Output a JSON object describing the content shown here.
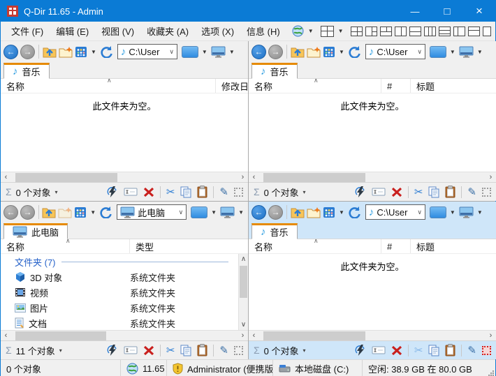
{
  "window": {
    "title": "Q-Dir 11.65 - Admin"
  },
  "menu": {
    "items": [
      "文件 (F)",
      "编辑 (E)",
      "视图 (V)",
      "收藏夹 (A)",
      "选项 (X)",
      "信息 (H)"
    ]
  },
  "panes": [
    {
      "name": "top-left",
      "active": false,
      "address": "C:\\User",
      "tab": "音乐",
      "columns": [
        "名称",
        "修改日"
      ],
      "empty_text": "此文件夹为空。",
      "status": {
        "count": "0 个对象"
      }
    },
    {
      "name": "top-right",
      "active": false,
      "address": "C:\\User",
      "tab": "音乐",
      "columns": [
        "名称",
        "#",
        "标题"
      ],
      "empty_text": "此文件夹为空。",
      "status": {
        "count": "0 个对象"
      }
    },
    {
      "name": "bottom-left",
      "active": false,
      "address": "此电脑",
      "tab": "此电脑",
      "columns": [
        "名称",
        "类型"
      ],
      "group": "文件夹 (7)",
      "rows": [
        {
          "name": "3D 对象",
          "type": "系统文件夹"
        },
        {
          "name": "视频",
          "type": "系统文件夹"
        },
        {
          "name": "图片",
          "type": "系统文件夹"
        },
        {
          "name": "文档",
          "type": "系统文件夹"
        }
      ],
      "status": {
        "count": "11 个对象"
      }
    },
    {
      "name": "bottom-right",
      "active": true,
      "address": "C:\\User",
      "tab": "音乐",
      "columns": [
        "名称",
        "#",
        "标题"
      ],
      "empty_text": "此文件夹为空。",
      "status": {
        "count": "0 个对象"
      }
    }
  ],
  "statusbar": {
    "objects": "0 个对象",
    "version": "11.65",
    "user": "Administrator (便携版",
    "drive": "本地磁盘 (C:)",
    "space": "空闲: 38.9 GB 在 80.0 GB"
  },
  "glyphs": {
    "back": "←",
    "forward": "→",
    "dropdown": "▼",
    "chevron": "∨",
    "caret_up": "∧",
    "scroll_left": "‹",
    "scroll_right": "›",
    "scroll_up": "∧",
    "scroll_down": "∨",
    "sigma": "Σ",
    "count_dropdown": "▾",
    "music": "♪",
    "minimize": "—",
    "maximize": "□",
    "close": "×",
    "scissors": "✂",
    "pencil": "✎"
  },
  "colors": {
    "titlebar": "#0b7bd5",
    "active_tab_accent": "#e68a00",
    "active_pane_bg": "#cfe6f9"
  }
}
